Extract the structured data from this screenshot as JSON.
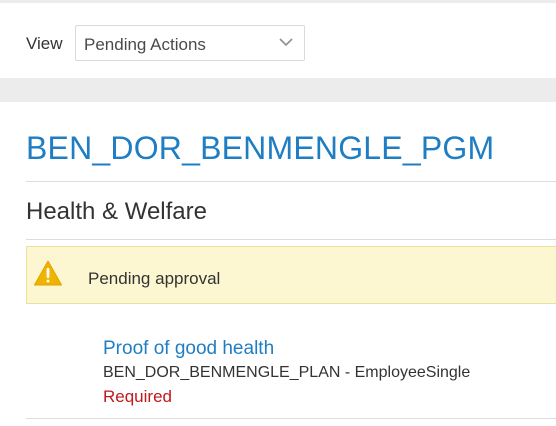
{
  "filter": {
    "label": "View",
    "selected": "Pending Actions"
  },
  "program": {
    "name": "BEN_DOR_BENMENGLE_PGM",
    "section": "Health & Welfare"
  },
  "alert": {
    "message": "Pending approval",
    "icon": "warning-icon",
    "color": "#f0b400"
  },
  "task": {
    "title": "Proof of good health",
    "plan": "BEN_DOR_BENMENGLE_PLAN - EmployeeSingle",
    "status": "Required",
    "status_color": "#c0191b"
  },
  "colors": {
    "accent": "#1f7ec3",
    "alert_bg": "#fcf7d1"
  }
}
